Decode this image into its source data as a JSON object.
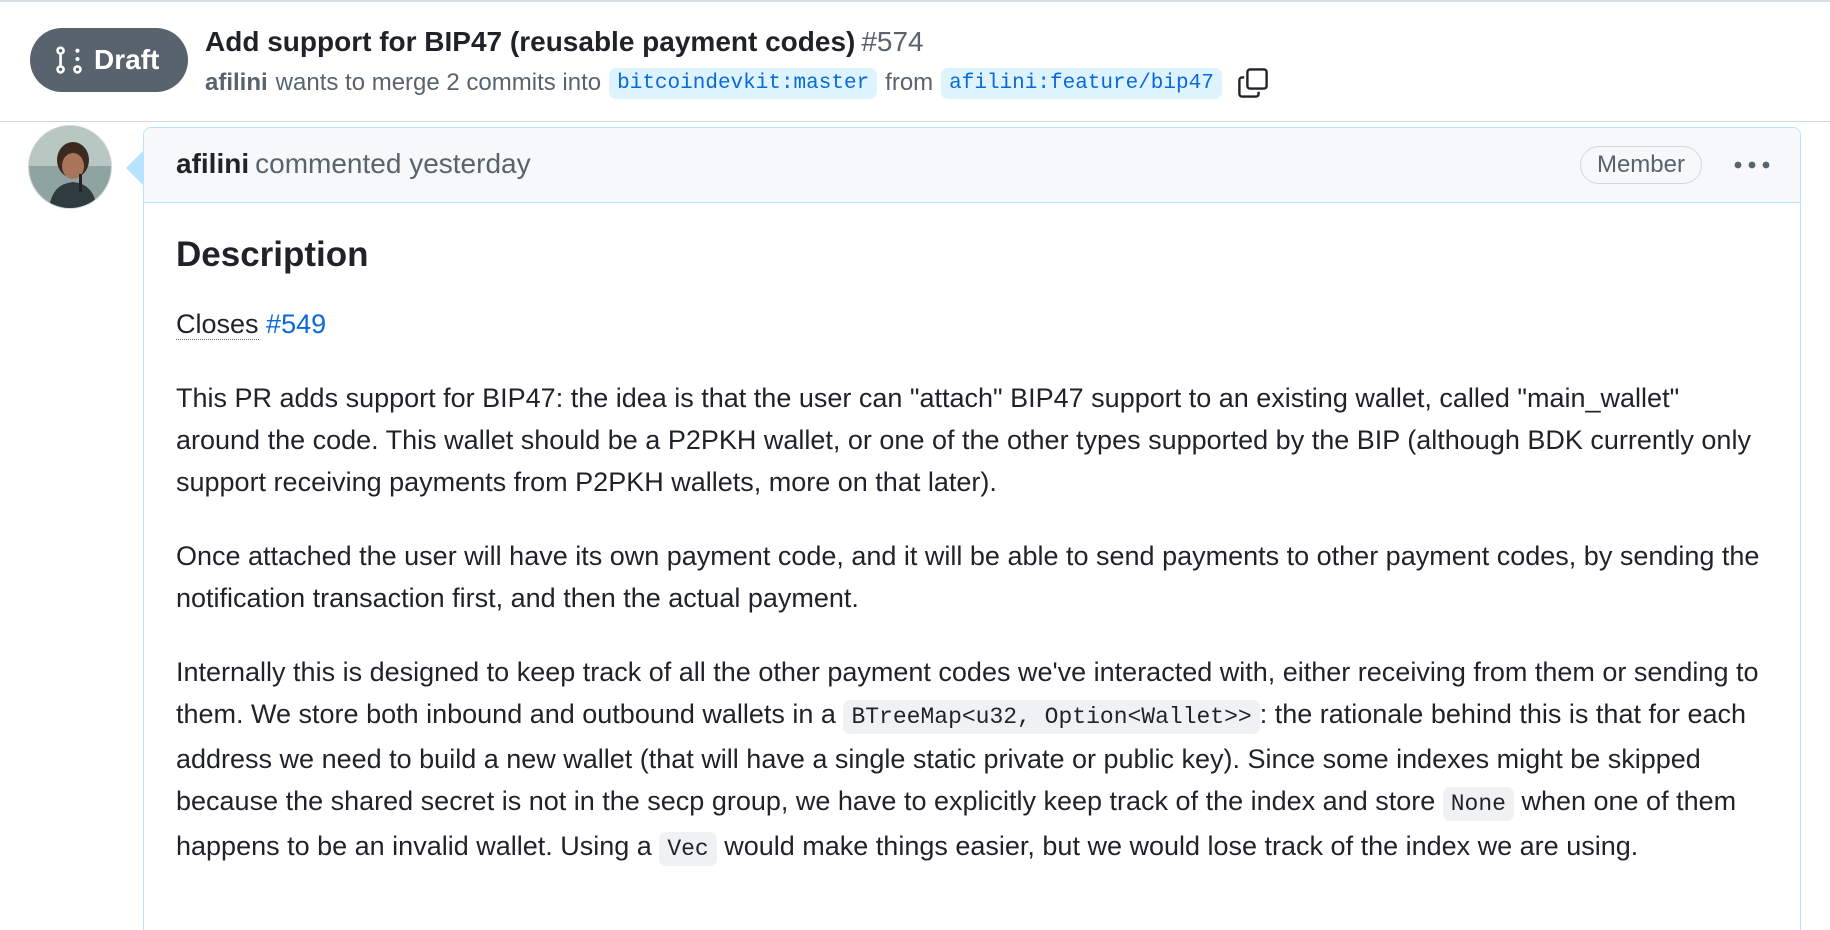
{
  "header": {
    "state": "Draft",
    "title": "Add support for BIP47 (reusable payment codes)",
    "number": "#574",
    "author": "afilini",
    "merge_text": "wants to merge 2 commits into",
    "base_branch": "bitcoindevkit:master",
    "from_text": "from",
    "head_branch": "afilini:feature/bip47"
  },
  "comment": {
    "author": "afilini",
    "timestamp": "commented yesterday",
    "role": "Member",
    "heading": "Description",
    "closes_label": "Closes",
    "closes_link": "#549",
    "p1": "This PR adds support for BIP47: the idea is that the user can \"attach\" BIP47 support to an existing wallet, called \"main_wallet\" around the code. This wallet should be a P2PKH wallet, or one of the other types supported by the BIP (although BDK currently only support receiving payments from P2PKH wallets, more on that later).",
    "p2": "Once attached the user will have its own payment code, and it will be able to send payments to other payment codes, by sending the notification transaction first, and then the actual payment.",
    "p3_a": "Internally this is designed to keep track of all the other payment codes we've interacted with, either receiving from them or sending to them. We store both inbound and outbound wallets in a ",
    "p3_code1": "BTreeMap<u32, Option<Wallet>>",
    "p3_b": ": the rationale behind this is that for each address we need to build a new wallet (that will have a single static private or public key). Since some indexes might be skipped because the shared secret is not in the secp group, we have to explicitly keep track of the index and store ",
    "p3_code2": "None",
    "p3_c": " when one of them happens to be an invalid wallet. Using a ",
    "p3_code3": "Vec",
    "p3_d": " would make things easier, but we would lose track of the index we are using."
  },
  "icons": {
    "state": "git-pull-request-draft-icon",
    "copy": "copy-icon",
    "kebab": "kebab-horizontal-icon"
  },
  "colors": {
    "draft_badge": "#59636e",
    "link": "#0969da",
    "branch_bg": "#ddf4ff",
    "comment_border": "#b6e3ff"
  }
}
